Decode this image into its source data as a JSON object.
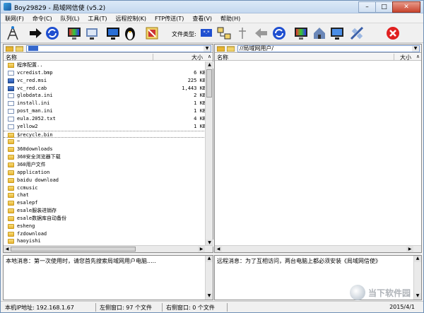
{
  "window": {
    "title": "Boy29829 - 局域网信使 (v5.2)",
    "min": "–",
    "max": "□",
    "close": "✕"
  },
  "menu": [
    "联网(F)",
    "命令(C)",
    "队列(L)",
    "工具(T)",
    "远程控制(K)",
    "FTP传送(T)",
    "查看(V)",
    "帮助(H)"
  ],
  "toolbar": {
    "filetype_label": "文件类型:",
    "filetype_value": "*.*"
  },
  "left_panel": {
    "path": "",
    "col_name": "名称",
    "col_size": "大小",
    "rows": [
      {
        "name": "程序配置..",
        "size": "",
        "icon": "up"
      },
      {
        "name": "vcredist.bmp",
        "size": "6 KB",
        "icon": "file"
      },
      {
        "name": "vc_red.msi",
        "size": "225 KB",
        "icon": "exe"
      },
      {
        "name": "vc_red.cab",
        "size": "1,443 KB",
        "icon": "exe"
      },
      {
        "name": "globdata.ini",
        "size": "2 KB",
        "icon": "file"
      },
      {
        "name": "install.ini",
        "size": "1 KB",
        "icon": "file"
      },
      {
        "name": "post_man.ini",
        "size": "1 KB",
        "icon": "file"
      },
      {
        "name": "eula.2052.txt",
        "size": "4 KB",
        "icon": "file"
      },
      {
        "name": "yellow2",
        "size": "1 KB",
        "icon": "file"
      },
      {
        "name": "$recycle.bin",
        "size": "",
        "icon": "folder"
      },
      {
        "name": "~",
        "size": "",
        "icon": "folder"
      },
      {
        "name": "360downloads",
        "size": "",
        "icon": "folder"
      },
      {
        "name": "360安全浏览器下载",
        "size": "",
        "icon": "folder"
      },
      {
        "name": "360用户文件",
        "size": "",
        "icon": "folder"
      },
      {
        "name": "application",
        "size": "",
        "icon": "folder"
      },
      {
        "name": "baidu download",
        "size": "",
        "icon": "folder"
      },
      {
        "name": "ccmusic",
        "size": "",
        "icon": "folder"
      },
      {
        "name": "chat",
        "size": "",
        "icon": "folder"
      },
      {
        "name": "esalepf",
        "size": "",
        "icon": "folder"
      },
      {
        "name": "esale服装进销存",
        "size": "",
        "icon": "folder"
      },
      {
        "name": "esale数据库自动备份",
        "size": "",
        "icon": "folder"
      },
      {
        "name": "esheng",
        "size": "",
        "icon": "folder"
      },
      {
        "name": "fzdownload",
        "size": "",
        "icon": "folder"
      },
      {
        "name": "haoyishi",
        "size": "",
        "icon": "folder"
      }
    ]
  },
  "right_panel": {
    "path": "//局域网用户/",
    "col_name": "名称",
    "col_size": "大小"
  },
  "messages": {
    "local": "本地消息：第一次使用时，请您首先搜索局域网用户电脑.....",
    "remote": "远程消息：为了互相访问，两台电脑上都必须安装《局域网信使》"
  },
  "status": {
    "ip": "本机IP地址: 192.168.1.67",
    "left": "左侧窗口: 97 个文件",
    "right": "右侧窗口: 0 个文件",
    "date": "2015/4/1"
  },
  "watermark": "当下软件园",
  "icons": [
    "network-icon",
    "arrow-right-icon",
    "refresh-icon",
    "monitor-color-icon",
    "screen-icon",
    "monitor-icon",
    "penguin-icon",
    "tools-icon",
    "network-share-icon",
    "arrow-left-icon",
    "refresh-icon",
    "monitor-color-icon",
    "house-icon",
    "display-icon",
    "satellite-icon",
    "close-red-icon"
  ]
}
